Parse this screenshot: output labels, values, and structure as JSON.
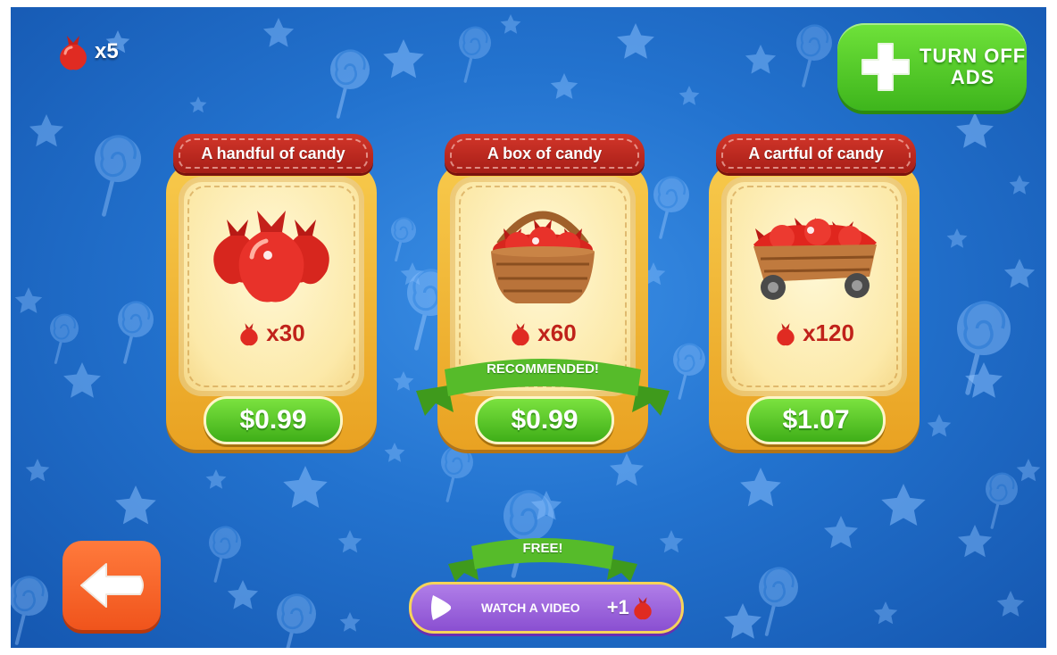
{
  "hud": {
    "candy_count": "x5",
    "candy_icon": "candy-bag-icon"
  },
  "ads_button": {
    "line1": "TURN OFF",
    "line2": "ADS",
    "icon": "plus-icon"
  },
  "packs": [
    {
      "title": "A handful of candy",
      "quantity": "x30",
      "price": "$0.99",
      "art": "candy-bags-icon"
    },
    {
      "title": "A box of candy",
      "quantity": "x60",
      "price": "$0.99",
      "art": "candy-basket-icon",
      "badge": "RECOMMENDED!"
    },
    {
      "title": "A cartful of candy",
      "quantity": "x120",
      "price": "$1.07",
      "art": "candy-cart-icon"
    }
  ],
  "free_offer": {
    "badge": "FREE!",
    "label": "WATCH A VIDEO",
    "bonus": "+1",
    "icon": "play-icon"
  },
  "back_button": {
    "icon": "arrow-left-icon"
  },
  "colors": {
    "background": "#2373cf",
    "card": "#f0b53a",
    "title_banner": "#c02a20",
    "price_button": "#52c626",
    "ads_button": "#52c626",
    "video_button": "#9a62dc",
    "back_button": "#f5622a"
  }
}
